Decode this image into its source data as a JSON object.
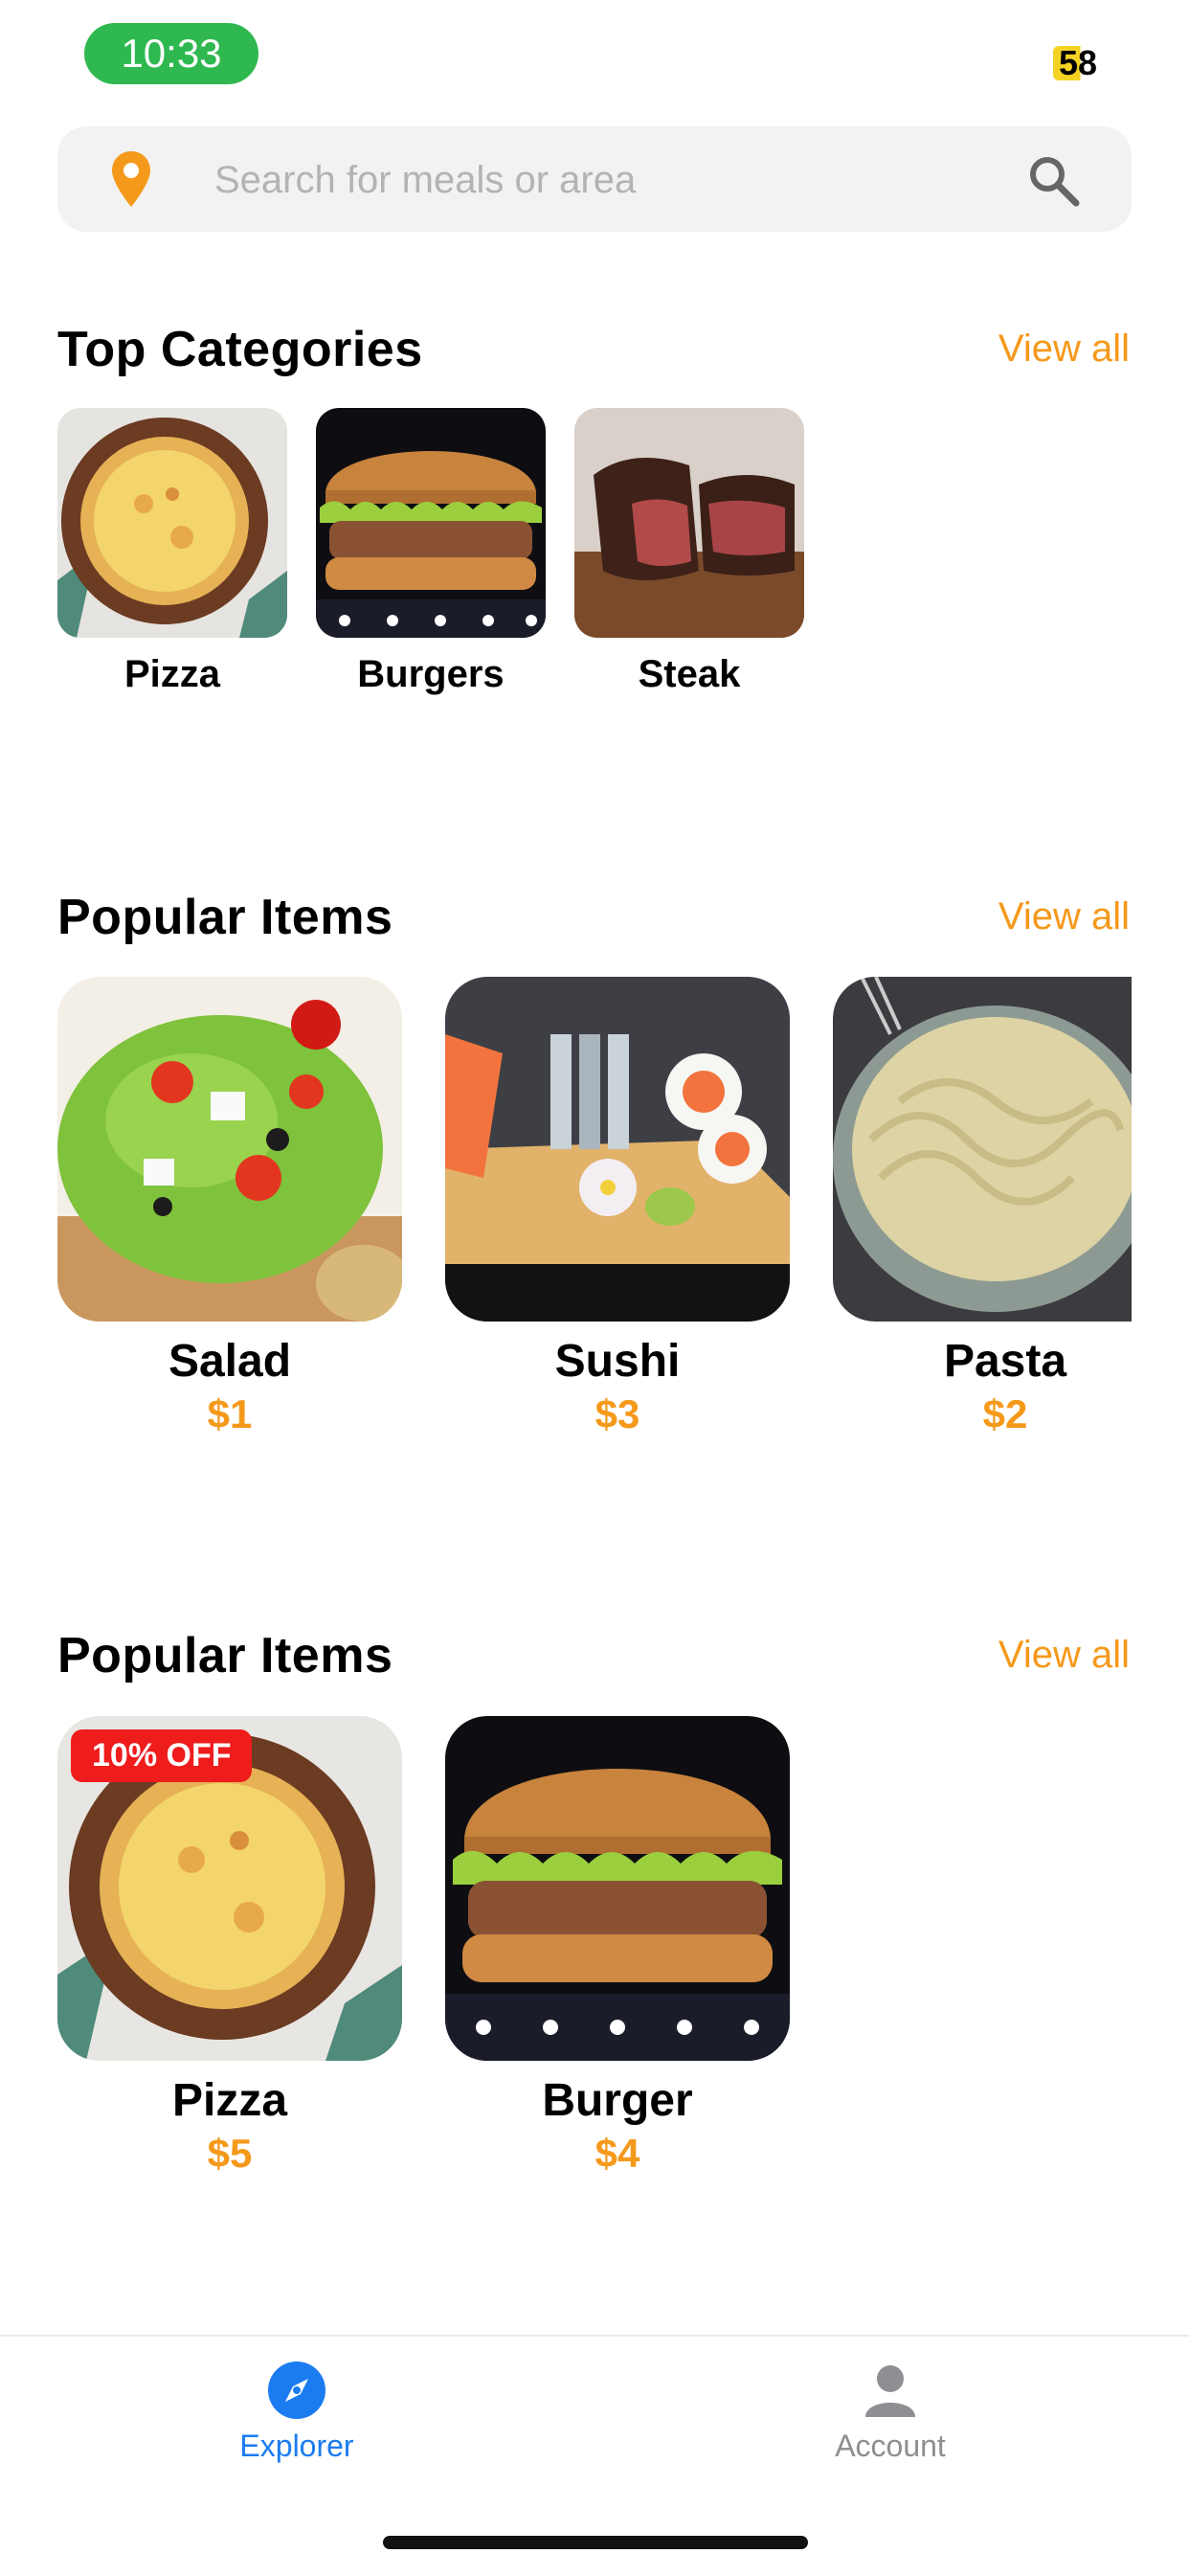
{
  "status_bar": {
    "time": "10:33",
    "battery": "58"
  },
  "search": {
    "placeholder": "Search for meals or area"
  },
  "top_categories": {
    "title": "Top Categories",
    "view_all": "View all",
    "items": [
      {
        "label": "Pizza"
      },
      {
        "label": "Burgers"
      },
      {
        "label": "Steak"
      }
    ]
  },
  "popular_items_1": {
    "title": "Popular Items",
    "view_all": "View all",
    "items": [
      {
        "name": "Salad",
        "price": "$1"
      },
      {
        "name": "Sushi",
        "price": "$3"
      },
      {
        "name": "Pasta",
        "price": "$2"
      }
    ]
  },
  "popular_items_2": {
    "title": "Popular Items",
    "view_all": "View all",
    "items": [
      {
        "name": "Pizza",
        "price": "$5",
        "badge": "10% OFF"
      },
      {
        "name": "Burger",
        "price": "$4"
      }
    ]
  },
  "tab_bar": {
    "tabs": [
      {
        "label": "Explorer",
        "icon": "compass-icon",
        "active": true
      },
      {
        "label": "Account",
        "icon": "person-icon",
        "active": false
      }
    ]
  },
  "colors": {
    "accent": "#f5991b",
    "active_tab": "#1a7cf0",
    "badge": "#ef1c1c",
    "time_pill": "#2fb84f"
  }
}
